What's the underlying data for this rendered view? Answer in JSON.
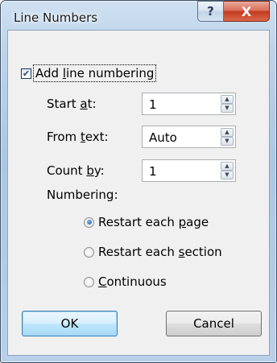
{
  "window": {
    "title": "Line Numbers",
    "help_glyph": "?",
    "close_glyph": "X"
  },
  "add_line_numbering": {
    "label_pre": "Add ",
    "label_key": "l",
    "label_post": "ine numbering",
    "checked": true,
    "check_glyph": "✔"
  },
  "start_at": {
    "label_pre": "Start ",
    "label_key": "a",
    "label_post": "t:",
    "value": "1"
  },
  "from_text": {
    "label_pre": "From ",
    "label_key": "t",
    "label_post": "ext:",
    "value": "Auto"
  },
  "count_by": {
    "label_pre": "Count ",
    "label_key": "b",
    "label_post": "y:",
    "value": "1"
  },
  "numbering": {
    "label": "Numbering:",
    "options": [
      {
        "pre": "Restart each ",
        "key": "p",
        "post": "age",
        "selected": true
      },
      {
        "pre": "Restart each ",
        "key": "s",
        "post": "ection",
        "selected": false
      },
      {
        "pre": "",
        "key": "C",
        "post": "ontinuous",
        "selected": false
      }
    ]
  },
  "spin_up_glyph": "▲",
  "spin_down_glyph": "▼",
  "buttons": {
    "ok": "OK",
    "cancel": "Cancel"
  },
  "colors": {
    "accent": "#3c7fb1",
    "close": "#c43c20"
  }
}
